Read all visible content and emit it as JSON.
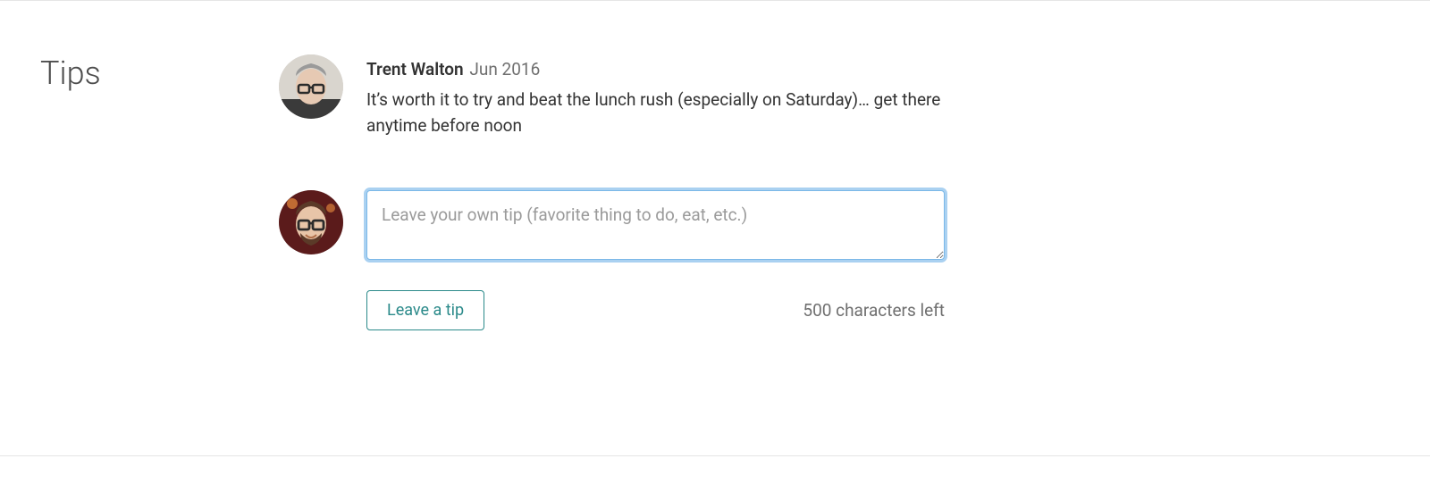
{
  "section": {
    "title": "Tips"
  },
  "tips": [
    {
      "author": "Trent Walton",
      "date": "Jun 2016",
      "text": "It’s worth it to try and beat the lunch rush (especially on Saturday)… get there anytime before noon"
    }
  ],
  "compose": {
    "placeholder": "Leave your own tip (favorite thing to do, eat, etc.)",
    "button_label": "Leave a tip",
    "char_counter": "500 characters left"
  }
}
